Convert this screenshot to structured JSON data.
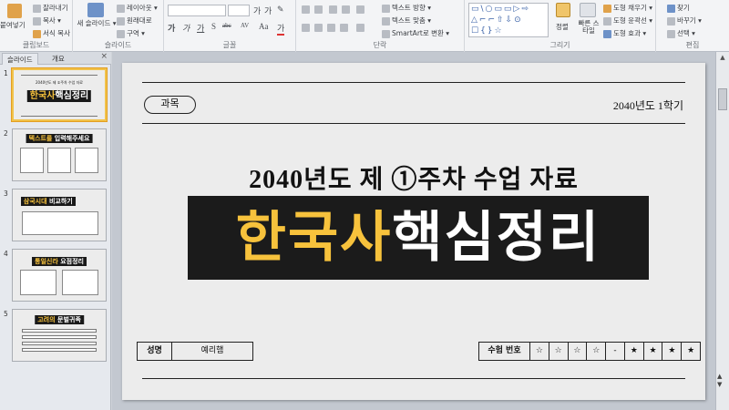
{
  "ribbon": {
    "clipboard": {
      "paste": "붙여넣기",
      "cut": "잘라내기",
      "copy": "복사 ▾",
      "format_painter": "서식 복사",
      "group_label": "클립보드"
    },
    "slides": {
      "new_slide": "새 슬라이드 ▾",
      "layout": "레이아웃 ▾",
      "reset": "원래대로",
      "section": "구역 ▾",
      "group_label": "슬라이드"
    },
    "font": {
      "font_name": "",
      "font_size": "",
      "group_label": "글꼴",
      "row2": [
        "가",
        "가",
        "가",
        "S",
        "abc",
        "AV",
        "Aa",
        "가"
      ]
    },
    "paragraph": {
      "text_direction": "텍스트 방향 ▾",
      "align_text": "텍스트 맞춤 ▾",
      "smartart": "SmartArt로 변환 ▾",
      "group_label": "단락"
    },
    "drawing": {
      "arrange": "정렬",
      "quick_styles": "빠른 스타일",
      "shape_fill": "도형 채우기 ▾",
      "shape_outline": "도형 윤곽선 ▾",
      "shape_effects": "도형 효과 ▾",
      "group_label": "그리기"
    },
    "editing": {
      "find": "찾기",
      "replace": "바꾸기 ▾",
      "select": "선택 ▾",
      "group_label": "편집"
    }
  },
  "pane": {
    "tabs": [
      "슬라이드",
      "개요"
    ],
    "close": "×",
    "thumbs": [
      {
        "num": "1",
        "yellow": "한국사",
        "white": "핵심정리",
        "caption": "2040년도 제 ①주차 수업 자료"
      },
      {
        "num": "2",
        "yellow": "텍스트를",
        "white": " 입력해주세요",
        "caption": ""
      },
      {
        "num": "3",
        "yellow": "삼국시대",
        "white": " 비교하기",
        "caption": ""
      },
      {
        "num": "4",
        "yellow": "통일신라",
        "white": " 요점정리",
        "caption": ""
      },
      {
        "num": "5",
        "yellow": "고려의",
        "white": " 문벌귀족",
        "caption": ""
      }
    ]
  },
  "slide": {
    "subject_pill": "과목",
    "term": "2040년도 1학기",
    "subtitle": "2040년도 제 ①주차 수업 자료",
    "title_yellow": "한국사",
    "title_white": "핵심정리",
    "name_label": "성명",
    "name_value": "예리햄",
    "exam_label": "수험 번호",
    "exam_cells": [
      "☆",
      "☆",
      "☆",
      "☆",
      "-",
      "★",
      "★",
      "★",
      "★"
    ]
  },
  "colors": {
    "accent_yellow": "#f7c23c",
    "title_bar": "#1b1b1b",
    "slide_bg": "#ececec"
  }
}
